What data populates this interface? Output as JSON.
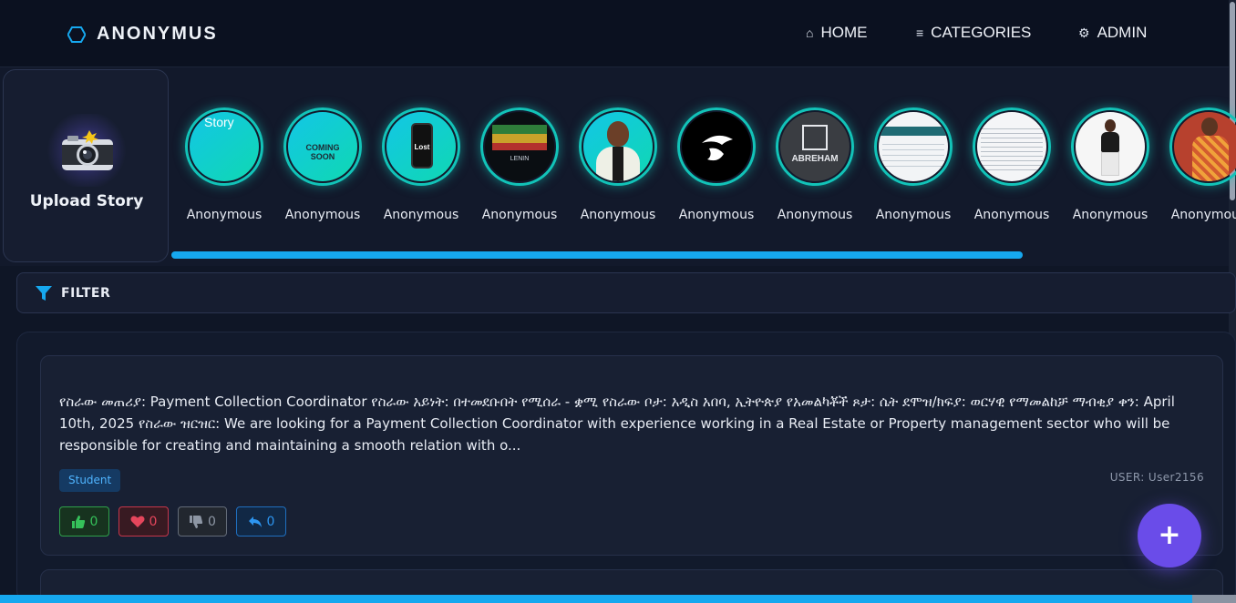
{
  "header": {
    "brand": "ANONYMUS",
    "nav": [
      {
        "label": "HOME",
        "icon": "home-icon"
      },
      {
        "label": "CATEGORIES",
        "icon": "list-icon"
      },
      {
        "label": "ADMIN",
        "icon": "gear-icon"
      }
    ]
  },
  "upload": {
    "label": "Upload Story",
    "icon": "camera-icon"
  },
  "stories": [
    {
      "name": "Anonymous",
      "thumb_text": "Story"
    },
    {
      "name": "Anonymous",
      "thumb_text": "COMING SOON"
    },
    {
      "name": "Anonymous",
      "thumb_text": "Lost"
    },
    {
      "name": "Anonymous",
      "thumb_text": "LENIN"
    },
    {
      "name": "Anonymous"
    },
    {
      "name": "Anonymous"
    },
    {
      "name": "Anonymous",
      "thumb_text": "ABREHAM"
    },
    {
      "name": "Anonymous"
    },
    {
      "name": "Anonymous"
    },
    {
      "name": "Anonymous"
    },
    {
      "name": "Anonymous"
    }
  ],
  "filter": {
    "label": "FILTER",
    "icon": "filter-icon"
  },
  "post": {
    "text": "የስራው መጠሪያ: Payment Collection Coordinator የስራው አይነት: በተመደቡበት የሚሰራ - ቋሚ የስራው ቦታ: አዲስ አበባ, ኢትዮጵያ የአመልካቾች ጾታ: ሴት ደሞዝ/ክፍያ: ወርሃዊ የማመልከቻ ማብቂያ ቀን: April 10th, 2025 የስራው ዝርዝር: We are looking for a Payment Collection Coordinator with experience working in a Real Estate or Property management sector who will be responsible for creating and maintaining a smooth relation with o...",
    "tag": "Student",
    "user": "USER: User2156",
    "likes": "0",
    "hearts": "0",
    "dislikes": "0",
    "replies": "0"
  },
  "fab": {
    "label": "+"
  },
  "colors": {
    "background": "#0f1626",
    "accent_blue": "#16a8ef",
    "story_ring": "#12c3b8",
    "fab": "#6a4ce9",
    "like": "#35c15a",
    "heart": "#e5465c",
    "reply": "#2d95f0"
  }
}
